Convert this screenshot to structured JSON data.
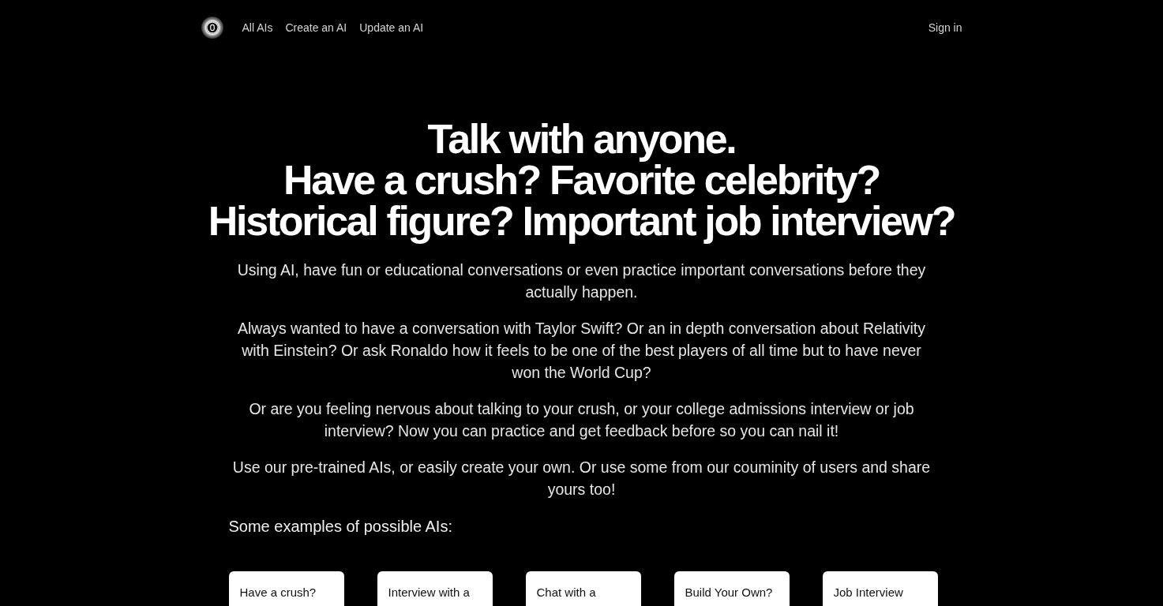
{
  "nav": {
    "links": [
      {
        "label": "All AIs"
      },
      {
        "label": "Create an AI"
      },
      {
        "label": "Update an AI"
      }
    ],
    "sign_in": "Sign in"
  },
  "hero": {
    "title_lines": [
      "Talk with anyone.",
      "Have a crush? Favorite celebrity?",
      "Historical figure? Important job interview?"
    ],
    "paragraphs": [
      "Using AI, have fun or educational conversations or even practice important conversations before they actually happen.",
      "Always wanted to have a conversation with Taylor Swift? Or an in depth conversation about Relativity with Einstein? Or ask Ronaldo how it feels to be one of the best players of all time but to have never won the World Cup?",
      "Or are you feeling nervous about talking to your crush, or your college admissions interview or job interview? Now you can practice and get feedback before so you can nail it!",
      "Use our pre-trained AIs, or easily create your own. Or use some from our couminity of users and share yours too!"
    ],
    "examples_heading": "Some examples of possible AIs:"
  },
  "examples": [
    {
      "title": "Have a crush?"
    },
    {
      "title": "Interview with a"
    },
    {
      "title": "Chat with a"
    },
    {
      "title": "Build Your Own?"
    },
    {
      "title": "Job Interview"
    }
  ]
}
